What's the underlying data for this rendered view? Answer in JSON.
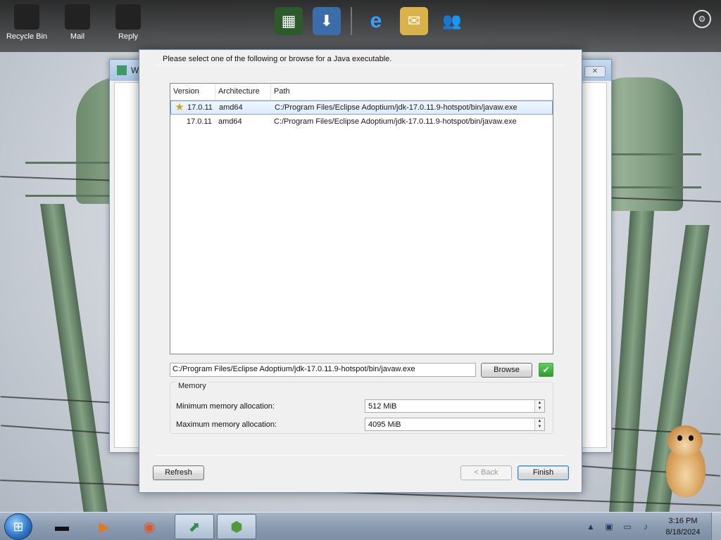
{
  "desktop": {
    "icons": [
      {
        "label": "Recycle Bin"
      },
      {
        "label": "Mail"
      },
      {
        "label": "Reply"
      }
    ],
    "background_window": {
      "title": "Wi",
      "close_label": "✕"
    }
  },
  "top_dock": {
    "apps": [
      {
        "name": "minecraft-edit-icon",
        "glyph": "▦"
      },
      {
        "name": "download-icon",
        "glyph": "⬇"
      },
      {
        "name": "internet-explorer-icon",
        "glyph": "e"
      },
      {
        "name": "mail-icon",
        "glyph": "✉"
      },
      {
        "name": "users-icon",
        "glyph": "👥"
      }
    ],
    "options_glyph": "⚙"
  },
  "dialog": {
    "description": "Please select one of the following or browse for a Java executable.",
    "table": {
      "columns": [
        "Version",
        "Architecture",
        "Path"
      ],
      "rows": [
        {
          "version": "17.0.11",
          "architecture": "amd64",
          "path": "C:/Program Files/Eclipse Adoptium/jdk-17.0.11.9-hotspot/bin/javaw.exe",
          "recommended": true
        },
        {
          "version": "17.0.11",
          "architecture": "amd64",
          "path": "C:/Program Files/Eclipse Adoptium/jdk-17.0.11.9-hotspot/bin/javaw.exe",
          "recommended": false
        }
      ]
    },
    "java_path": "C:/Program Files/Eclipse Adoptium/jdk-17.0.11.9-hotspot/bin/javaw.exe",
    "browse_label": "Browse",
    "check_glyph": "✔",
    "memory": {
      "legend": "Memory",
      "min_label": "Minimum memory allocation:",
      "min_value": "512 MiB",
      "max_label": "Maximum memory allocation:",
      "max_value": "4095 MiB"
    },
    "refresh_label": "Refresh",
    "back_label": "< Back",
    "finish_label": "Finish"
  },
  "taskbar": {
    "start_glyph": "⊞",
    "pinned": [
      {
        "name": "terminal-icon",
        "glyph": "▬"
      },
      {
        "name": "media-player-icon",
        "glyph": "▶"
      },
      {
        "name": "firefox-icon",
        "glyph": "◉"
      },
      {
        "name": "prism-launcher-icon",
        "glyph": "⬈"
      },
      {
        "name": "minecraft-icon",
        "glyph": "⬢"
      }
    ],
    "tray": {
      "show_hidden": "▲",
      "time": "3:16 PM",
      "date": "8/18/2024"
    }
  },
  "colors": {
    "accent_blue": "#3c7fb1",
    "check_green": "#2f9b2f",
    "taskbar": "#8b9bb0"
  }
}
